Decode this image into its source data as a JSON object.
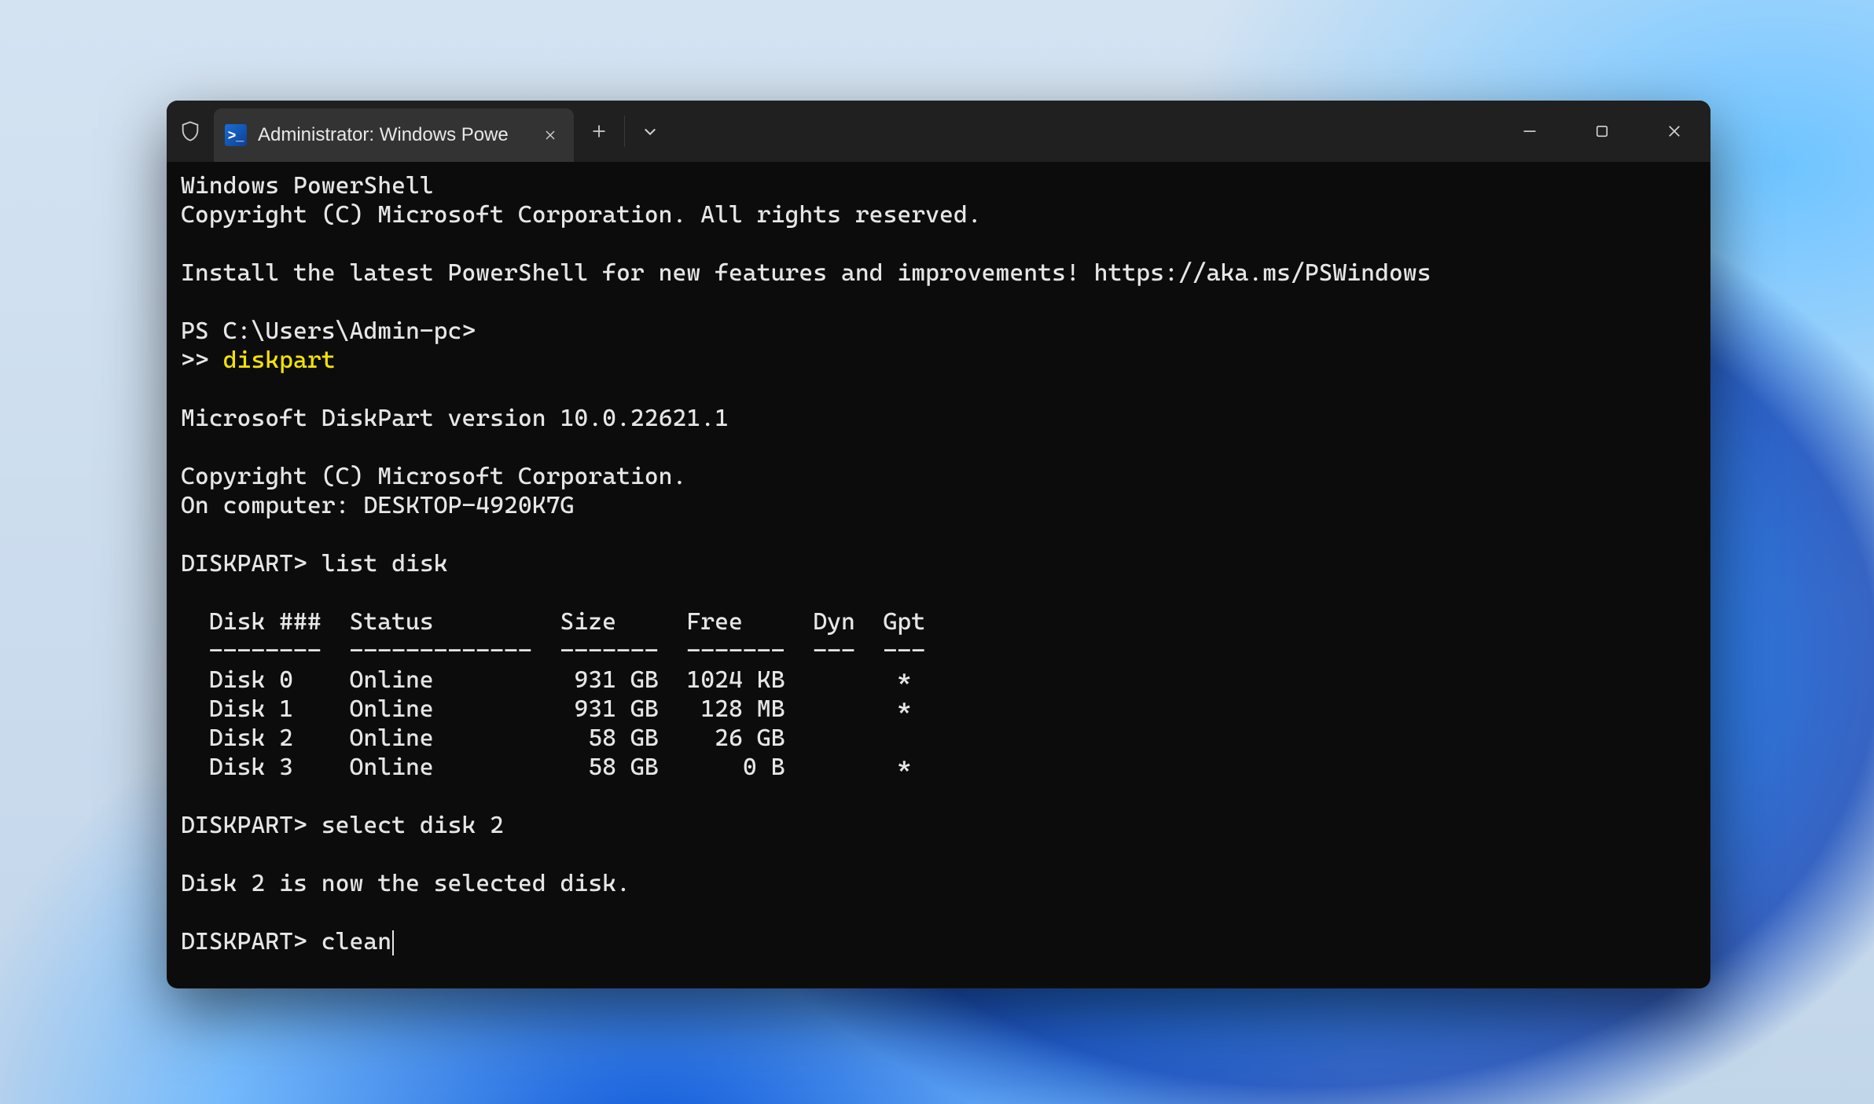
{
  "tab": {
    "title": "Administrator: Windows Powe"
  },
  "terminal": {
    "header1": "Windows PowerShell",
    "header2": "Copyright (C) Microsoft Corporation. All rights reserved.",
    "install_msg": "Install the latest PowerShell for new features and improvements! https://aka.ms/PSWindows",
    "prompt_ps": "PS C:\\Users\\Admin-pc>",
    "cont_prefix": ">> ",
    "cmd_diskpart": "diskpart",
    "dp_version": "Microsoft DiskPart version 10.0.22621.1",
    "dp_copyright": "Copyright (C) Microsoft Corporation.",
    "dp_computer": "On computer: DESKTOP-4920K7G",
    "dp_prompt": "DISKPART> ",
    "cmd_list": "list disk",
    "table_header": "  Disk ###  Status         Size     Free     Dyn  Gpt",
    "table_rule": "  --------  -------------  -------  -------  ---  ---",
    "disks": [
      {
        "row": "  Disk 0    Online          931 GB  1024 KB        *"
      },
      {
        "row": "  Disk 1    Online          931 GB   128 MB        *"
      },
      {
        "row": "  Disk 2    Online           58 GB    26 GB"
      },
      {
        "row": "  Disk 3    Online           58 GB      0 B        *"
      }
    ],
    "cmd_select": "select disk 2",
    "select_result": "Disk 2 is now the selected disk.",
    "cmd_clean": "clean"
  }
}
